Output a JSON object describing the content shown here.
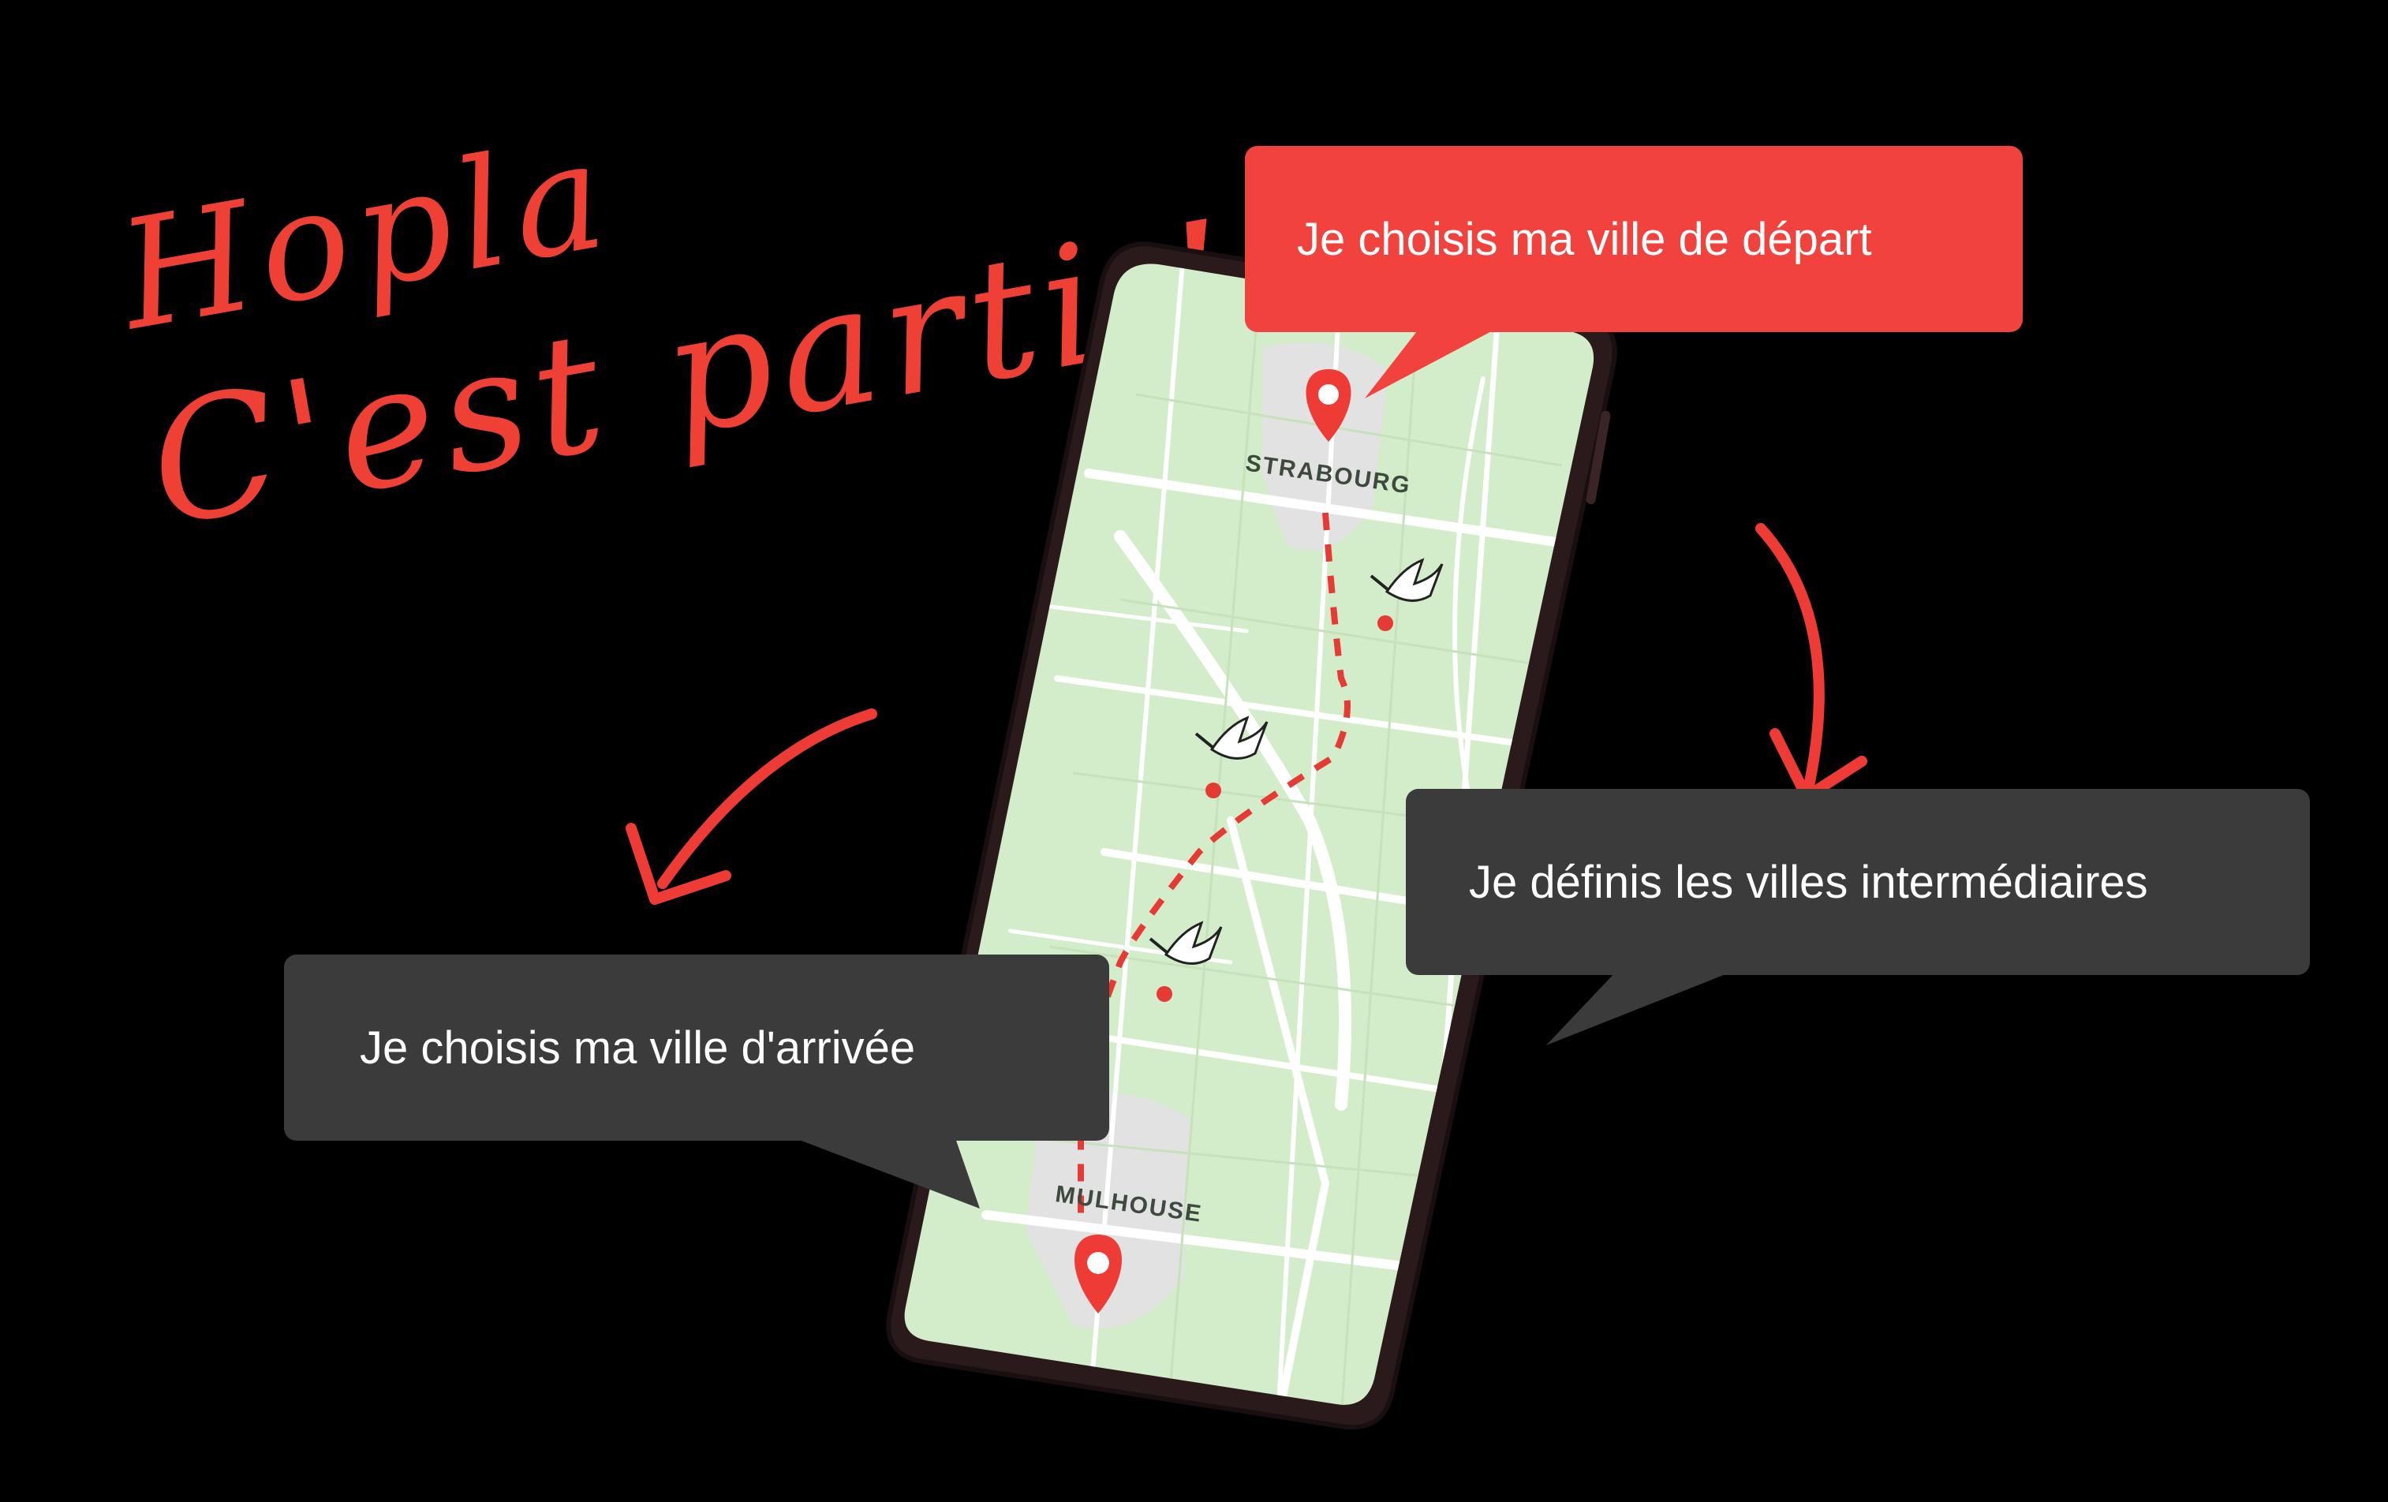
{
  "headline": {
    "line1": "Hopla",
    "line2": "C'est parti !"
  },
  "callouts": {
    "depart": "Je choisis ma ville de départ",
    "intermediaires": "Je définis les villes intermédiaires",
    "arrivee": "Je choisis ma ville d'arrivée"
  },
  "map": {
    "start_city": "STRABOURG",
    "end_city": "MULHOUSE",
    "stopover_markers": 3
  },
  "colors": {
    "accent_red": "#f1423d",
    "dark_bubble": "#3b3b3b",
    "map_green": "#d3ecc9",
    "road": "#ffffff",
    "phone_frame": "#2a1a1c"
  },
  "icons": [
    "map-pin-icon",
    "stork-icon",
    "hand-drawn-arrow-icon"
  ]
}
